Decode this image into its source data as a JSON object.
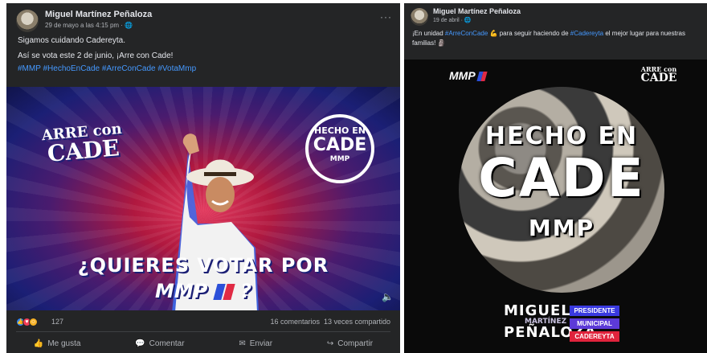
{
  "post_a": {
    "author": "Miguel Martínez Peñaloza",
    "meta": "29 de mayo a las 4:15 pm · 🌐",
    "more": "···",
    "text_line1": "Sigamos cuidando Cadereyta.",
    "text_line2": "Así se vota este 2 de junio, ¡Arre con Cade!",
    "hashtags": "#MMP #HechoEnCade #ArreConCade #VotaMmp",
    "image": {
      "arre_top": "ARRE con",
      "arre_bottom": "CADE",
      "badge_top": "HECHO EN",
      "badge_mid": "CADE",
      "badge_bottom": "MMP",
      "question_line1": "¿QUIERES VOTAR POR",
      "question_mmp": "MMP",
      "question_end": "?",
      "volume_icon": "speaker-icon"
    },
    "reaction_count": "127",
    "comments": "16 comentarios",
    "shares": "13 veces compartido",
    "actions": {
      "like": "Me gusta",
      "comment": "Comentar",
      "send": "Enviar",
      "share": "Compartir"
    }
  },
  "post_b": {
    "author": "Miguel Martínez Peñaloza",
    "meta": "19 de abril · 🌐",
    "text_start": "¡En unidad ",
    "tag1": "#ArreConCade",
    "text_mid": " 💪 para seguir haciendo de ",
    "tag2": "#Cadereyta",
    "text_end": " el mejor lugar para nuestras familias! 🗿",
    "image": {
      "logo_mmp": "MMP",
      "arre_top": "ARRE con",
      "arre_bottom": "CADE",
      "circle_top": "HECHO EN",
      "circle_mid": "CADE",
      "circle_bottom": "MMP",
      "name1": "MIGUEL",
      "name2": "MARTÍNEZ",
      "name3": "PEÑALOZA",
      "role1": "PRESIDENTE",
      "role2": "MUNICIPAL",
      "role3": "CADEREYTA"
    }
  },
  "colors": {
    "card_bg": "#242526",
    "link_blue": "#4599ff",
    "flag_blue": "#2b4fd8",
    "flag_red": "#e02a44",
    "role_blue": "#3a3ae0",
    "role_purple": "#5c3ad8",
    "role_red": "#e0233c"
  }
}
